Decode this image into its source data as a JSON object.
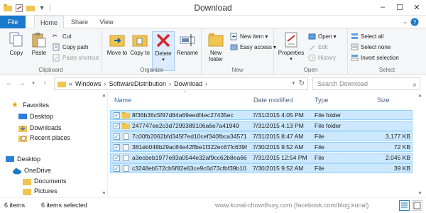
{
  "window": {
    "title": "Download"
  },
  "ribbon_tabs": [
    "File",
    "Home",
    "Share",
    "View"
  ],
  "clipboard": {
    "copy": "Copy",
    "paste": "Paste",
    "cut": "Cut",
    "copy_path": "Copy path",
    "paste_shortcut": "Paste shortcut",
    "label": "Clipboard"
  },
  "organize": {
    "move_to": "Move to",
    "copy_to": "Copy to",
    "delete": "Delete",
    "rename": "Rename",
    "label": "Organize"
  },
  "new_group": {
    "new_folder": "New folder",
    "new_item": "New item",
    "easy_access": "Easy access",
    "label": "New"
  },
  "open_group": {
    "properties": "Properties",
    "open": "Open",
    "edit": "Edit",
    "history": "History",
    "label": "Open"
  },
  "select_group": {
    "select_all": "Select all",
    "select_none": "Select none",
    "invert": "Invert selection",
    "label": "Select"
  },
  "address": {
    "crumbs": [
      "Windows",
      "SoftwareDistribution",
      "Download"
    ],
    "search_placeholder": "Search Download"
  },
  "nav": {
    "favorites": "Favorites",
    "desktop": "Desktop",
    "downloads": "Downloads",
    "recent": "Recent places",
    "desktop_root": "Desktop",
    "onedrive": "OneDrive",
    "documents": "Documents",
    "pictures": "Pictures"
  },
  "columns": {
    "name": "Name",
    "date": "Date modified",
    "type": "Type",
    "size": "Size"
  },
  "files": [
    {
      "name": "8f36b36c5f97d84a69eedf4ec27435ec",
      "date": "7/31/2015 4:05 PM",
      "type": "File folder",
      "size": "",
      "kind": "folder"
    },
    {
      "name": "247747ee2c3d7299389106a6e7a41949",
      "date": "7/31/2015 4:13 PM",
      "type": "File folder",
      "size": "",
      "kind": "folder"
    },
    {
      "name": "7c00fb2062bfd345f7ed10cef340fbca34571...",
      "date": "7/31/2015 8:47 AM",
      "type": "File",
      "size": "3,177 KB",
      "kind": "file"
    },
    {
      "name": "381eb048b29ac84e42ffbe1f322ec67fc6396...",
      "date": "7/30/2015 9:52 AM",
      "type": "File",
      "size": "72 KB",
      "kind": "file"
    },
    {
      "name": "a3ecbeb1977e83a0544e32af9cc62b8ea66c...",
      "date": "7/31/2015 12:54 PM",
      "type": "File",
      "size": "2,045 KB",
      "kind": "file"
    },
    {
      "name": "c3248eb572cb5f82e63ce9c6d73cfbf39b10...",
      "date": "7/30/2015 9:52 AM",
      "type": "File",
      "size": "39 KB",
      "kind": "file"
    }
  ],
  "status": {
    "items": "6 items",
    "selected": "6 items selected",
    "credit": "www.kunal-chowdhury.com (facebook.com/blog.kunal)"
  },
  "colors": {
    "accent": "#1979ca",
    "selection": "#cce8ff",
    "selection_border": "#99d1ff",
    "folder": "#f0c550"
  }
}
